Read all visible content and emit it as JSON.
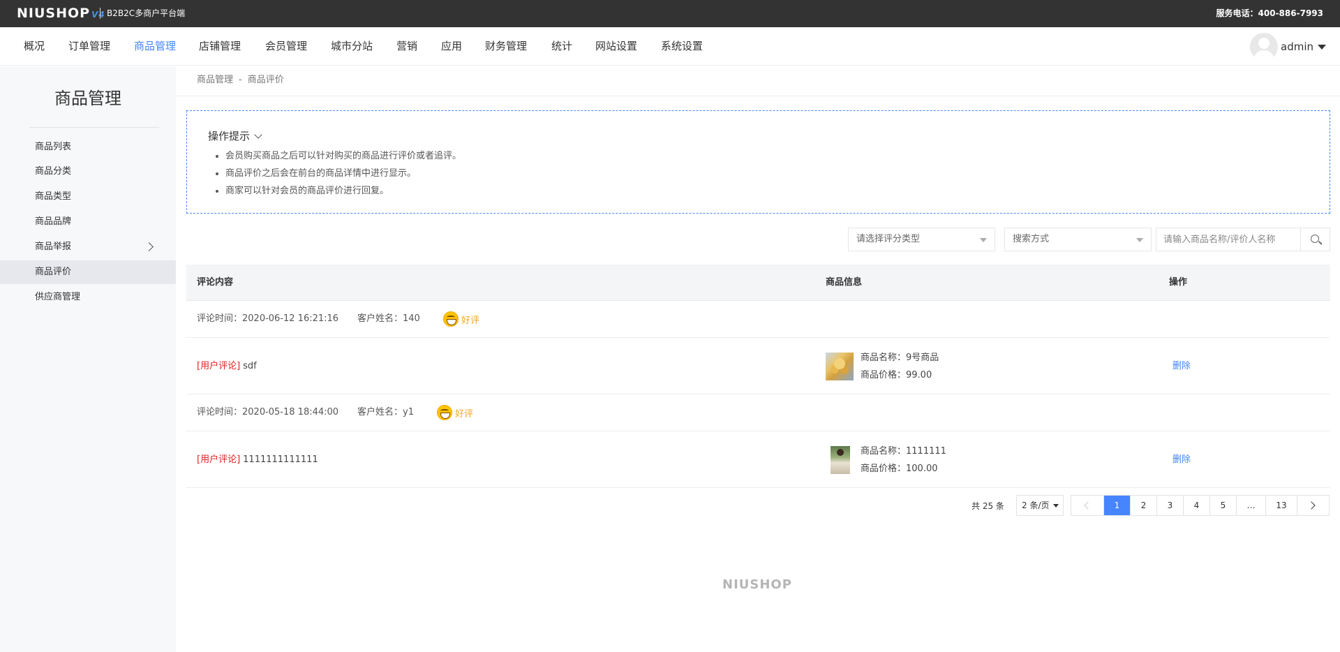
{
  "header": {
    "logo_text": "NIUSHOP",
    "logo_version": "V4",
    "platform": "B2B2C多商户平台端",
    "service": "服务电话：400-886-7993"
  },
  "nav": {
    "items": [
      "概况",
      "订单管理",
      "商品管理",
      "店铺管理",
      "会员管理",
      "城市分站",
      "营销",
      "应用",
      "财务管理",
      "统计",
      "网站设置",
      "系统设置"
    ],
    "active": "商品管理",
    "user": "admin"
  },
  "sidebar": {
    "title": "商品管理",
    "items": [
      "商品列表",
      "商品分类",
      "商品类型",
      "商品品牌",
      "商品举报",
      "商品评价",
      "供应商管理"
    ],
    "active": "商品评价"
  },
  "breadcrumb": {
    "parent": "商品管理",
    "separator": "-",
    "current": "商品评价"
  },
  "tips": {
    "title": "操作提示",
    "items": [
      "会员购买商品之后可以针对购买的商品进行评价或者追评。",
      "商品评价之后会在前台的商品详情中进行显示。",
      "商家可以针对会员的商品评价进行回复。"
    ]
  },
  "filters": {
    "score_type_placeholder": "请选择评分类型",
    "search_mode_placeholder": "搜索方式",
    "search_placeholder": "请输入商品名称/评价人名称"
  },
  "table": {
    "headers": {
      "content": "评论内容",
      "goods": "商品信息",
      "action": "操作"
    },
    "rows": [
      {
        "time": "评论时间：2020-06-12 16:21:16",
        "customer": "客户姓名：140",
        "rating": "好评",
        "tag": "[用户评论]",
        "comment": "sdf",
        "goods_name": "商品名称：9号商品",
        "goods_price": "商品价格：99.00",
        "action": "删除"
      },
      {
        "time": "评论时间：2020-05-18 18:44:00",
        "customer": "客户姓名：y1",
        "rating": "好评",
        "tag": "[用户评论]",
        "comment": "1111111111111",
        "goods_name": "商品名称：1111111",
        "goods_price": "商品价格：100.00",
        "action": "删除"
      }
    ]
  },
  "pagination": {
    "total": "共 25 条",
    "page_size": "2 条/页",
    "pages": [
      "1",
      "2",
      "3",
      "4",
      "5",
      "…",
      "13"
    ],
    "current": "1"
  },
  "footer": {
    "logo": "NIUSHOP"
  },
  "colors": {
    "accent": "#4685ff",
    "topbar": "#333333",
    "tag_red": "#e02020",
    "rating_orange": "#f5a623"
  }
}
